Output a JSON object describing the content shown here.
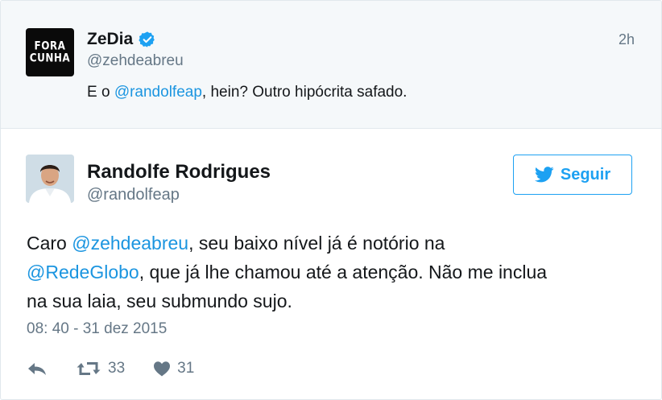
{
  "colors": {
    "link": "#1b95e0",
    "follow_accent": "#1da1f2",
    "muted_text": "#657786",
    "parent_background": "#f5f8fa"
  },
  "parent_tweet": {
    "avatar": {
      "icon": "fora-cunha-avatar",
      "text_line1": "FORA",
      "text_line2": "CUNHA"
    },
    "name": "ZeDia",
    "verified_icon": "verified-badge-icon",
    "handle": "@zehdeabreu",
    "time": "2h",
    "text": {
      "prefix": "E o ",
      "mention": "@randolfeap",
      "suffix": ", hein? Outro hipócrita safado."
    }
  },
  "main_tweet": {
    "avatar": {
      "icon": "randolfe-avatar"
    },
    "name": "Randolfe Rodrigues",
    "handle": "@randolfeap",
    "follow_button": {
      "icon": "twitter-bird-icon",
      "label": "Seguir"
    },
    "text": {
      "line1_prefix": "Caro ",
      "line1_mention": "@zehdeabreu",
      "line1_suffix": ", seu baixo nível já é notório na",
      "line2_mention": "@RedeGlobo",
      "line2_suffix": ", que já lhe chamou até a atenção. Não me inclua",
      "line3": "na sua laia, seu submundo sujo."
    },
    "timestamp": "08: 40 - 31 dez 2015",
    "actions": {
      "reply": {
        "icon": "reply-icon"
      },
      "retweet": {
        "icon": "retweet-icon",
        "count": "33"
      },
      "like": {
        "icon": "heart-icon",
        "count": "31"
      }
    }
  }
}
